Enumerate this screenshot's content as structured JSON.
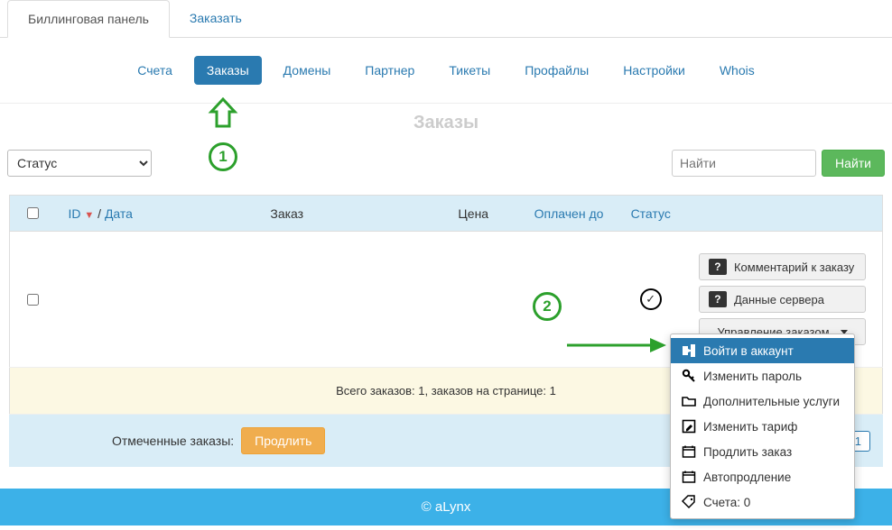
{
  "top_tabs": {
    "billing": "Биллинговая панель",
    "order": "Заказать"
  },
  "nav": {
    "invoices": "Счета",
    "orders": "Заказы",
    "domains": "Домены",
    "partner": "Партнер",
    "tickets": "Тикеты",
    "profiles": "Профайлы",
    "settings": "Настройки",
    "whois": "Whois"
  },
  "heading": "Заказы",
  "filter": {
    "status_label": "Статус"
  },
  "search": {
    "placeholder": "Найти",
    "button": "Найти"
  },
  "table": {
    "head": {
      "id": "ID",
      "date": "Дата",
      "order": "Заказ",
      "price": "Цена",
      "paid_until": "Оплачен до",
      "status": "Статус"
    },
    "summary": "Всего заказов: 1, заказов на странице: 1"
  },
  "actions": {
    "comment": "Комментарий к заказу",
    "server_data": "Данные сервера",
    "manage": "Управление заказом"
  },
  "dropdown": {
    "login": "Войти в аккаунт",
    "change_password": "Изменить пароль",
    "extra_services": "Дополнительные услуги",
    "change_plan": "Изменить тариф",
    "renew": "Продлить заказ",
    "autorenew": "Автопродление",
    "bills": "Счета: 0"
  },
  "footer": {
    "label": "Отмеченные заказы:",
    "renew_btn": "Продлить",
    "page": "1"
  },
  "bottom": "© aLynx",
  "ann": {
    "one": "1",
    "two": "2"
  }
}
